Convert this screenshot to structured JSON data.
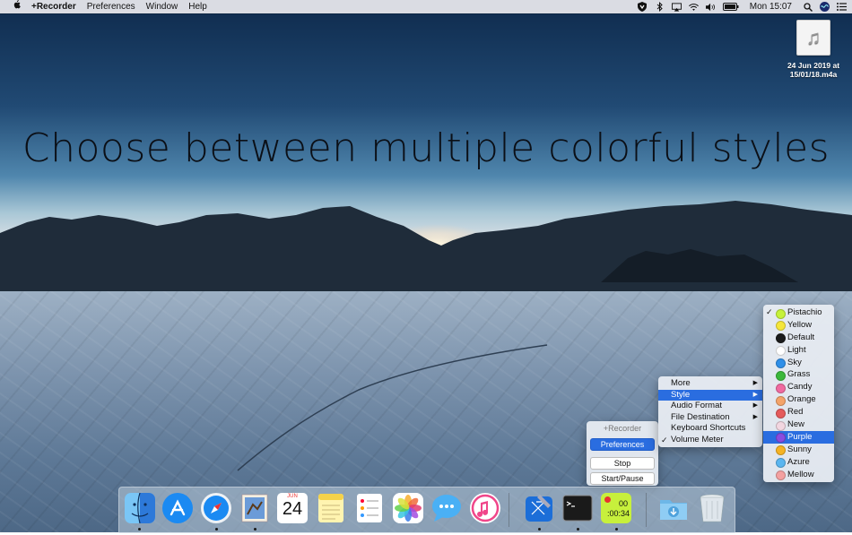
{
  "menubar": {
    "apple_icon": "apple-icon",
    "app_name": "+Recorder",
    "items": [
      "Preferences",
      "Window",
      "Help"
    ],
    "clock": "Mon 15:07",
    "status_icons": [
      "shield-icon",
      "bluetooth-icon",
      "airplay-icon",
      "wifi-icon",
      "volume-icon",
      "battery-icon",
      "search-icon",
      "siri-icon",
      "notification-list-icon"
    ]
  },
  "desktop": {
    "headline": "Choose between multiple colorful styles",
    "file": {
      "icon": "music-note-icon",
      "name_line1": "24 Jun 2019 at",
      "name_line2": "15/01/18.m4a"
    }
  },
  "popup": {
    "title": "+Recorder",
    "preferences_label": "Preferences",
    "stop_label": "Stop",
    "startpause_label": "Start/Pause"
  },
  "context_menu": {
    "items": [
      {
        "label": "More",
        "submenu": true,
        "checked": false,
        "selected": false
      },
      {
        "label": "Style",
        "submenu": true,
        "checked": false,
        "selected": true
      },
      {
        "label": "Audio Format",
        "submenu": true,
        "checked": false,
        "selected": false
      },
      {
        "label": "File Destination",
        "submenu": true,
        "checked": false,
        "selected": false
      },
      {
        "label": "Keyboard Shortcuts",
        "submenu": false,
        "checked": false,
        "selected": false
      },
      {
        "label": "Volume Meter",
        "submenu": false,
        "checked": true,
        "selected": false
      }
    ]
  },
  "style_menu": {
    "items": [
      {
        "label": "Pistachio",
        "color": "#c6f23a",
        "checked": true,
        "selected": false
      },
      {
        "label": "Yellow",
        "color": "#f5e63b",
        "checked": false,
        "selected": false
      },
      {
        "label": "Default",
        "color": "#1b1b1b",
        "checked": false,
        "selected": false
      },
      {
        "label": "Light",
        "color": "#ffffff",
        "checked": false,
        "selected": false
      },
      {
        "label": "Sky",
        "color": "#2f8fe8",
        "checked": false,
        "selected": false
      },
      {
        "label": "Grass",
        "color": "#3bb83b",
        "checked": false,
        "selected": false
      },
      {
        "label": "Candy",
        "color": "#f06aa0",
        "checked": false,
        "selected": false
      },
      {
        "label": "Orange",
        "color": "#f4a46a",
        "checked": false,
        "selected": false
      },
      {
        "label": "Red",
        "color": "#e55b5b",
        "checked": false,
        "selected": false
      },
      {
        "label": "New",
        "color": "#f2d6e0",
        "checked": false,
        "selected": false
      },
      {
        "label": "Purple",
        "color": "#8a4ce0",
        "checked": false,
        "selected": true
      },
      {
        "label": "Sunny",
        "color": "#f5b324",
        "checked": false,
        "selected": false
      },
      {
        "label": "Azure",
        "color": "#5bb6f0",
        "checked": false,
        "selected": false
      },
      {
        "label": "Mellow",
        "color": "#f3a0a0",
        "checked": false,
        "selected": false
      }
    ]
  },
  "dock": {
    "apps": [
      {
        "name": "finder-icon",
        "running": true
      },
      {
        "name": "app-store-icon",
        "running": false
      },
      {
        "name": "safari-icon",
        "running": true
      },
      {
        "name": "mail-icon",
        "running": true
      },
      {
        "name": "calendar-icon",
        "running": false
      },
      {
        "name": "notes-icon",
        "running": false
      },
      {
        "name": "reminders-icon",
        "running": false
      },
      {
        "name": "photos-icon",
        "running": false
      },
      {
        "name": "messages-icon",
        "running": false
      },
      {
        "name": "itunes-icon",
        "running": false
      },
      {
        "name": "xcode-icon",
        "running": true
      },
      {
        "name": "terminal-icon",
        "running": true
      },
      {
        "name": "recorder-icon",
        "running": true
      },
      {
        "name": "downloads-folder-icon",
        "running": false
      },
      {
        "name": "trash-icon",
        "running": false
      }
    ],
    "calendar_month": "JUN",
    "calendar_day": "24",
    "recorder_time_line1": "00",
    "recorder_time_line2": ":00:34"
  }
}
